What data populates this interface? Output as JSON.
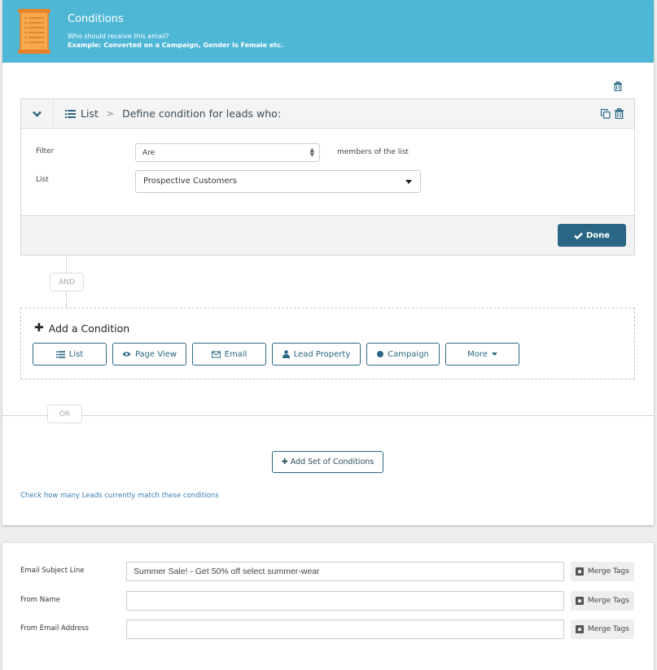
{
  "banner": {
    "icon": "scroll-checklist-icon",
    "title": "Conditions",
    "subtitle": "Who should receive this email?",
    "example": "Example: Converted on a Campaign, Gender Is Female etc."
  },
  "condition": {
    "type_icon": "list-icon",
    "type_label": "List",
    "separator": ">",
    "header_text": "Define condition for leads who:",
    "filter_label": "Filter",
    "filter_value": "Are",
    "filter_suffix": "members of the list",
    "list_label": "List",
    "list_value": "Prospective Customers",
    "done_label": "Done"
  },
  "connectors": {
    "and_label": "AND",
    "or_label": "OR"
  },
  "add_condition": {
    "title": "Add a Condition",
    "buttons": [
      {
        "label": "List",
        "icon": "list-icon"
      },
      {
        "label": "Page View",
        "icon": "eye-icon"
      },
      {
        "label": "Email",
        "icon": "envelope-icon"
      },
      {
        "label": "Lead Property",
        "icon": "user-icon"
      },
      {
        "label": "Campaign",
        "icon": "circle-icon"
      },
      {
        "label": "More",
        "icon": "caret-down-icon"
      }
    ]
  },
  "add_set_label": "Add Set of Conditions",
  "check_link": "Check how many Leads currently match these conditions",
  "email_settings": {
    "fields": [
      {
        "label": "Email Subject Line",
        "value": "Summer Sale! - Get 50% off select summer-wear",
        "placeholder": ""
      },
      {
        "label": "From Name",
        "value": "",
        "placeholder": ""
      },
      {
        "label": "From Email Address",
        "value": "",
        "placeholder": ""
      }
    ],
    "merge_label": "Merge Tags"
  },
  "colors": {
    "banner": "#4fb7d6",
    "primary": "#2b6784",
    "link": "#3a7fb0"
  }
}
